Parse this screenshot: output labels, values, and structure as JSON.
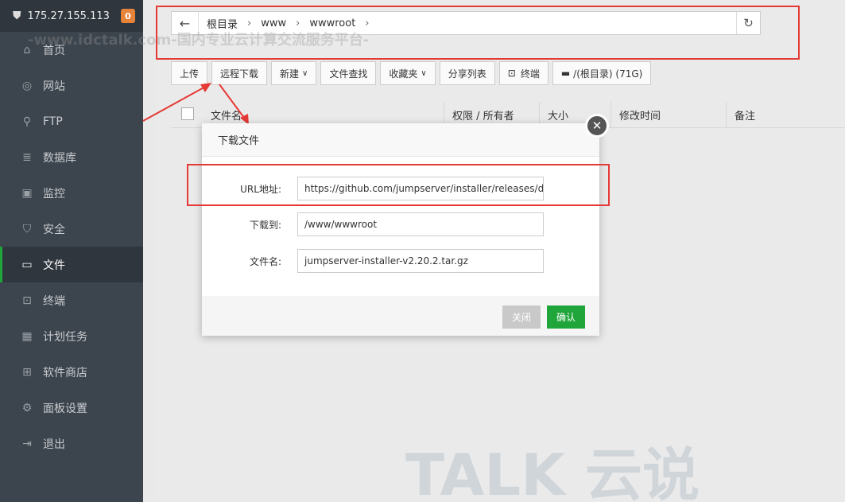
{
  "server": {
    "ip": "175.27.155.113",
    "badge": "0"
  },
  "sidebar": {
    "items": [
      {
        "label": "首页",
        "icon": "home-icon"
      },
      {
        "label": "网站",
        "icon": "globe-icon"
      },
      {
        "label": "FTP",
        "icon": "ftp-icon"
      },
      {
        "label": "数据库",
        "icon": "database-icon"
      },
      {
        "label": "监控",
        "icon": "monitor-icon"
      },
      {
        "label": "安全",
        "icon": "shield-icon"
      },
      {
        "label": "文件",
        "icon": "folder-icon",
        "active": true
      },
      {
        "label": "终端",
        "icon": "terminal-icon"
      },
      {
        "label": "计划任务",
        "icon": "calendar-icon"
      },
      {
        "label": "软件商店",
        "icon": "grid-icon"
      },
      {
        "label": "面板设置",
        "icon": "gear-icon"
      },
      {
        "label": "退出",
        "icon": "logout-icon"
      }
    ]
  },
  "path": {
    "crumbs": [
      "根目录",
      "www",
      "wwwroot"
    ]
  },
  "toolbar": {
    "upload": "上传",
    "remote_download": "远程下载",
    "new": "新建",
    "file_search": "文件查找",
    "favorites": "收藏夹",
    "share_list": "分享列表",
    "terminal": "终端",
    "disk": "/(根目录) (71G)"
  },
  "table": {
    "headers": [
      "文件名",
      "权限 / 所有者",
      "大小",
      "修改时间",
      "备注"
    ]
  },
  "modal": {
    "title": "下载文件",
    "url_label": "URL地址:",
    "url_value": "https://github.com/jumpserver/installer/releases/do",
    "dest_label": "下载到:",
    "dest_value": "/www/wwwroot",
    "filename_label": "文件名:",
    "filename_value": "jumpserver-installer-v2.20.2.tar.gz",
    "close_label": "关闭",
    "ok_label": "确认"
  },
  "watermark": {
    "brand": "TALK 云说",
    "line": "-www.idctalk.com-国内专业云计算交流服务平台-"
  },
  "colors": {
    "accent": "#20a53a",
    "sidebar": "#3c444d",
    "annotation": "#e53935",
    "badge": "#e8833a"
  }
}
